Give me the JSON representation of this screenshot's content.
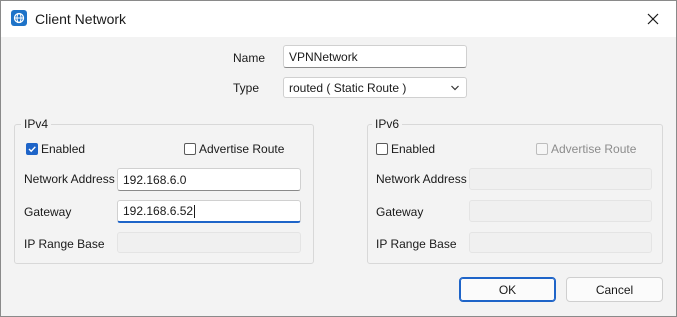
{
  "window": {
    "title": "Client Network",
    "app_icon": "network-icon",
    "close_icon": "close-icon"
  },
  "form": {
    "name_label": "Name",
    "name_value": "VPNNetwork",
    "type_label": "Type",
    "type_value": "routed  ( Static Route )"
  },
  "ipv4": {
    "group_label": "IPv4",
    "enabled_label": "Enabled",
    "enabled_checked": true,
    "advertise_label": "Advertise Route",
    "advertise_checked": false,
    "network_address_label": "Network Address",
    "network_address_value": "192.168.6.0",
    "gateway_label": "Gateway",
    "gateway_value": "192.168.6.52",
    "ip_range_base_label": "IP Range Base",
    "ip_range_base_value": ""
  },
  "ipv6": {
    "group_label": "IPv6",
    "enabled_label": "Enabled",
    "enabled_checked": false,
    "advertise_label": "Advertise Route",
    "advertise_checked": false,
    "network_address_label": "Network Address",
    "gateway_label": "Gateway",
    "ip_range_base_label": "IP Range Base"
  },
  "buttons": {
    "ok": "OK",
    "cancel": "Cancel"
  },
  "colors": {
    "accent": "#1e64c8",
    "window_bg": "#f3f3f3"
  }
}
